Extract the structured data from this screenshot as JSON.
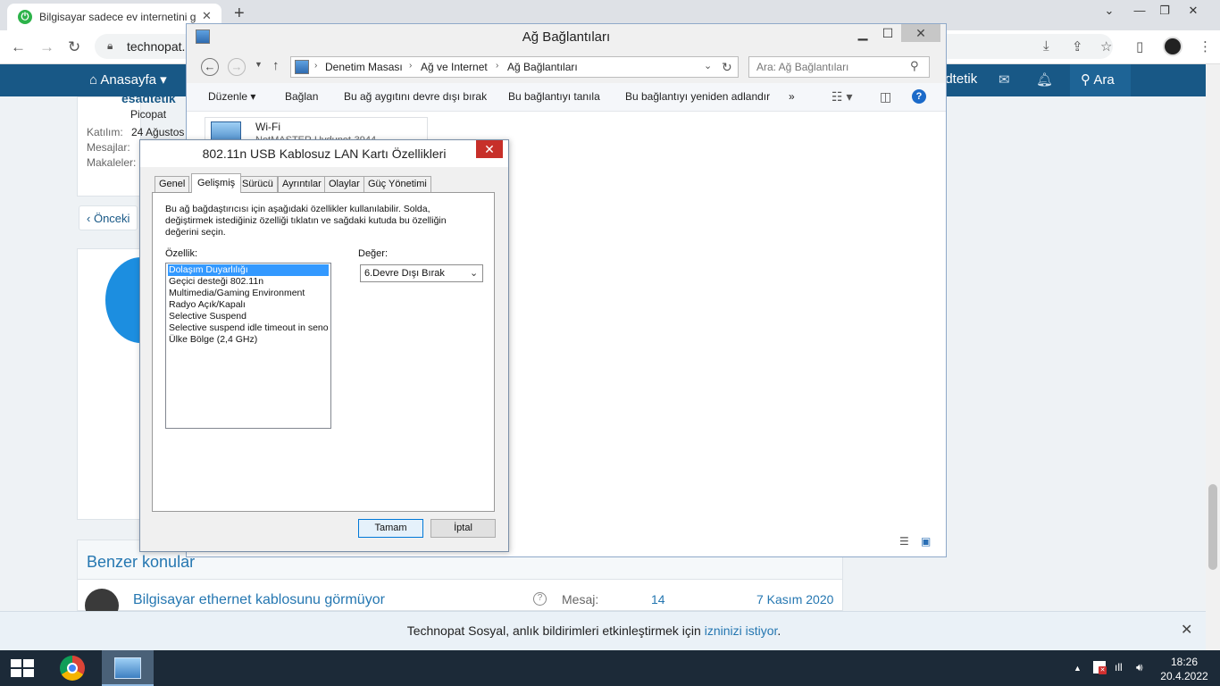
{
  "browser": {
    "tab_title": "Bilgisayar sadece ev internetini g",
    "url": "technopat.",
    "colors": {
      "tab_bar": "#dee1e6",
      "nav_blue": "#185886"
    }
  },
  "site": {
    "nav_home": "Anasayfa",
    "nav_user": "adtetik",
    "nav_search": "Ara",
    "profile": {
      "username": "esadtetik",
      "title": "Picopat",
      "join_label": "Katılım:",
      "join_value": "24 Ağustos",
      "messages_label": "Mesajlar:",
      "articles_label": "Makaleler:"
    },
    "prev_label": "Önceki",
    "similar": {
      "title": "Benzer konular",
      "topic": "Bilgisayar ethernet kablosunu görmüyor",
      "message_label": "Mesaj:",
      "message_count": "14",
      "date": "7 Kasım 2020"
    },
    "notification": {
      "text": "Technopat Sosyal, anlık bildirimleri etkinleştirmek için ",
      "link": "izninizi istiyor",
      "suffix": "."
    }
  },
  "explorer": {
    "title": "Ağ Bağlantıları",
    "breadcrumb": [
      "Denetim Masası",
      "Ağ ve Internet",
      "Ağ Bağlantıları"
    ],
    "search_placeholder": "Ara: Ağ Bağlantıları",
    "commands": [
      "Düzenle",
      "Bağlan",
      "Bu ağ aygıtını devre dışı bırak",
      "Bu bağlantıyı tanıla",
      "Bu bağlantıyı yeniden adlandır"
    ],
    "more": "»",
    "connection": {
      "name": "Wi-Fi",
      "sub": "NetMASTER Uydunet-3944"
    }
  },
  "dialog": {
    "title": "802.11n USB Kablosuz LAN Kartı Özellikleri",
    "tabs": [
      "Genel",
      "Gelişmiş",
      "Sürücü",
      "Ayrıntılar",
      "Olaylar",
      "Güç Yönetimi"
    ],
    "active_tab": "Gelişmiş",
    "description": "Bu ağ bağdaştırıcısı için aşağıdaki özellikler kullanılabilir. Solda, değiştirmek istediğiniz özelliği tıklatın ve sağdaki kutuda bu özelliğin değerini seçin.",
    "property_label": "Özellik:",
    "value_label": "Değer:",
    "properties": [
      "Dolaşım Duyarlılığı",
      "Geçici desteği 802.11n",
      "Multimedia/Gaming Environment",
      "Radyo Açık/Kapalı",
      "Selective Suspend",
      "Selective suspend idle timeout in seno",
      "Ülke Bölge (2,4 GHz)"
    ],
    "selected_property": "Dolaşım Duyarlılığı",
    "value": "6.Devre Dışı Bırak",
    "ok": "Tamam",
    "cancel": "İptal",
    "selection_color": "#3399ff"
  },
  "taskbar": {
    "time": "18:26",
    "date": "20.4.2022",
    "color": "#1c2a38"
  }
}
